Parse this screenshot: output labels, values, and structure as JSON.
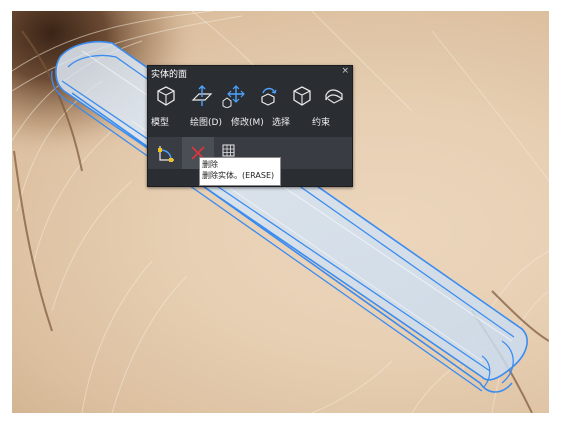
{
  "panel": {
    "title": "实体的面",
    "close_glyph": "×",
    "tools": [
      {
        "icon": "box-icon"
      },
      {
        "icon": "extrude-face-icon"
      },
      {
        "icon": "move-gizmo-icon"
      },
      {
        "icon": "rotate-face-icon"
      },
      {
        "icon": "cube-select-icon"
      },
      {
        "icon": "surface-icon"
      }
    ],
    "groups": {
      "model": "模型",
      "draw": "绘图(D)",
      "modify": "修改(M)",
      "select": "选择",
      "constraint": "约束"
    },
    "row2_tools": [
      {
        "icon": "vertex-edit-icon"
      },
      {
        "icon": "delete-x-icon"
      },
      {
        "icon": "grid-layout-icon"
      }
    ]
  },
  "tooltip": {
    "title": "删除",
    "description": "删除实体。(ERASE)"
  },
  "colors": {
    "viewport_bg": "#e7cfb3",
    "selection_blue": "#3b8cf0",
    "panel_bg": "#2a2d32",
    "delete_red": "#d9363e"
  }
}
